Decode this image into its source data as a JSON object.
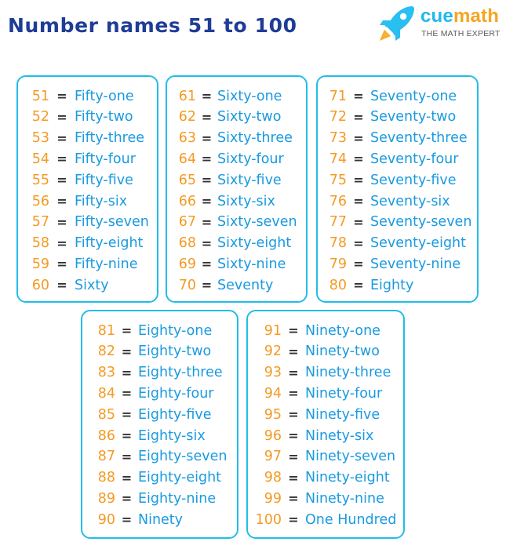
{
  "header": {
    "title": "Number names 51 to 100"
  },
  "logo": {
    "brand_part1": "cue",
    "brand_part2": "math",
    "tagline": "THE MATH EXPERT",
    "icon": "rocket-icon"
  },
  "colors": {
    "title": "#1f3d96",
    "number": "#f59a23",
    "word": "#1a9ae0",
    "box_border": "#22bde9",
    "brand_cue": "#1fb9ef",
    "brand_math": "#f7a51f"
  },
  "equals_sign": "=",
  "groups": [
    {
      "rows": [
        {
          "number": "51",
          "name": "Fifty-one"
        },
        {
          "number": "52",
          "name": "Fifty-two"
        },
        {
          "number": "53",
          "name": "Fifty-three"
        },
        {
          "number": "54",
          "name": "Fifty-four"
        },
        {
          "number": "55",
          "name": "Fifty-five"
        },
        {
          "number": "56",
          "name": "Fifty-six"
        },
        {
          "number": "57",
          "name": "Fifty-seven"
        },
        {
          "number": "58",
          "name": "Fifty-eight"
        },
        {
          "number": "59",
          "name": "Fifty-nine"
        },
        {
          "number": "60",
          "name": "Sixty"
        }
      ]
    },
    {
      "rows": [
        {
          "number": "61",
          "name": "Sixty-one"
        },
        {
          "number": "62",
          "name": "Sixty-two"
        },
        {
          "number": "63",
          "name": "Sixty-three"
        },
        {
          "number": "64",
          "name": "Sixty-four"
        },
        {
          "number": "65",
          "name": "Sixty-five"
        },
        {
          "number": "66",
          "name": "Sixty-six"
        },
        {
          "number": "67",
          "name": "Sixty-seven"
        },
        {
          "number": "68",
          "name": "Sixty-eight"
        },
        {
          "number": "69",
          "name": "Sixty-nine"
        },
        {
          "number": "70",
          "name": "Seventy"
        }
      ]
    },
    {
      "rows": [
        {
          "number": "71",
          "name": "Seventy-one"
        },
        {
          "number": "72",
          "name": "Seventy-two"
        },
        {
          "number": "73",
          "name": "Seventy-three"
        },
        {
          "number": "74",
          "name": "Seventy-four"
        },
        {
          "number": "75",
          "name": "Seventy-five"
        },
        {
          "number": "76",
          "name": "Seventy-six"
        },
        {
          "number": "77",
          "name": "Seventy-seven"
        },
        {
          "number": "78",
          "name": "Seventy-eight"
        },
        {
          "number": "79",
          "name": "Seventy-nine"
        },
        {
          "number": "80",
          "name": "Eighty"
        }
      ]
    },
    {
      "rows": [
        {
          "number": "81",
          "name": "Eighty-one"
        },
        {
          "number": "82",
          "name": "Eighty-two"
        },
        {
          "number": "83",
          "name": "Eighty-three"
        },
        {
          "number": "84",
          "name": "Eighty-four"
        },
        {
          "number": "85",
          "name": "Eighty-five"
        },
        {
          "number": "86",
          "name": "Eighty-six"
        },
        {
          "number": "87",
          "name": "Eighty-seven"
        },
        {
          "number": "88",
          "name": "Eighty-eight"
        },
        {
          "number": "89",
          "name": "Eighty-nine"
        },
        {
          "number": "90",
          "name": "Ninety"
        }
      ]
    },
    {
      "rows": [
        {
          "number": "91",
          "name": "Ninety-one"
        },
        {
          "number": "92",
          "name": "Ninety-two"
        },
        {
          "number": "93",
          "name": "Ninety-three"
        },
        {
          "number": "94",
          "name": "Ninety-four"
        },
        {
          "number": "95",
          "name": "Ninety-five"
        },
        {
          "number": "96",
          "name": "Ninety-six"
        },
        {
          "number": "97",
          "name": "Ninety-seven"
        },
        {
          "number": "98",
          "name": "Ninety-eight"
        },
        {
          "number": "99",
          "name": "Ninety-nine"
        },
        {
          "number": "100",
          "name": "One Hundred"
        }
      ]
    }
  ]
}
